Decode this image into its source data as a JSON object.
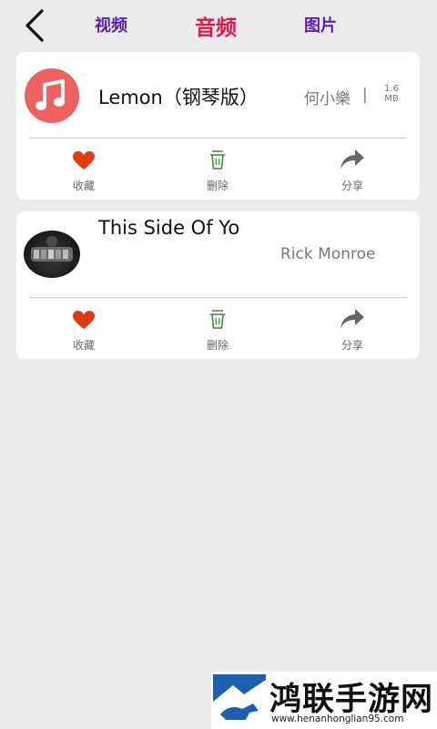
{
  "header": {
    "tabs": [
      {
        "label": "视频",
        "active": false
      },
      {
        "label": "音频",
        "active": true
      },
      {
        "label": "图片",
        "active": false
      }
    ]
  },
  "items": [
    {
      "title": "Lemon（钢琴版）",
      "artist": "何小樂",
      "separator": "|",
      "size_value": "1.6",
      "size_unit": "MB",
      "thumbnail_icon": "music-note-icon",
      "actions": [
        "收藏",
        "删除",
        "分享"
      ]
    },
    {
      "title": "This Side Of Yo",
      "artist": "Rick Monroe",
      "thumbnail_icon": "album-cover-photo",
      "actions": [
        "收藏",
        "删除",
        "分享"
      ]
    }
  ],
  "watermark": {
    "name": "鸿联手游网",
    "url": "www.henanhonglian95.com"
  },
  "colors": {
    "active_tab": "#e2174a",
    "tab": "#5a1cb8",
    "heart": "#e23b12",
    "trash": "#3f8a3f",
    "share": "#666666",
    "music_icon_bg": "#ef6161"
  }
}
